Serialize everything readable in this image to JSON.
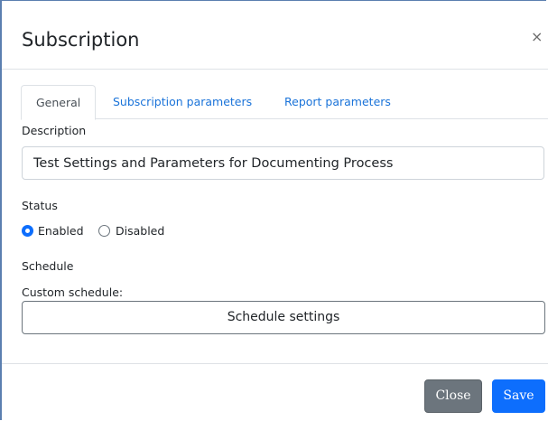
{
  "modal": {
    "title": "Subscription",
    "close_glyph": "×"
  },
  "tabs": [
    {
      "label": "General",
      "active": true
    },
    {
      "label": "Subscription parameters",
      "active": false
    },
    {
      "label": "Report parameters",
      "active": false
    }
  ],
  "description": {
    "label": "Description",
    "value": "Test Settings and Parameters for Documenting Process"
  },
  "status": {
    "label": "Status",
    "options": [
      {
        "label": "Enabled",
        "selected": true
      },
      {
        "label": "Disabled",
        "selected": false
      }
    ]
  },
  "schedule": {
    "label": "Schedule",
    "custom_label": "Custom schedule:",
    "button_label": "Schedule settings"
  },
  "footer": {
    "close_label": "Close",
    "save_label": "Save"
  },
  "colors": {
    "primary": "#0d6efd",
    "secondary": "#6c757d",
    "link": "#1a73d9"
  }
}
